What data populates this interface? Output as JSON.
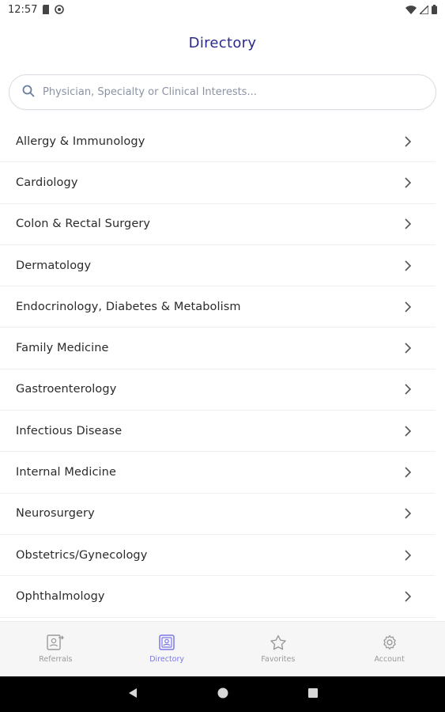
{
  "status_bar": {
    "time": "12:57"
  },
  "header": {
    "title": "Directory"
  },
  "search": {
    "placeholder": "Physician, Specialty or Clinical Interests..."
  },
  "specialties": [
    {
      "label": "Allergy & Immunology"
    },
    {
      "label": "Cardiology"
    },
    {
      "label": "Colon & Rectal Surgery"
    },
    {
      "label": "Dermatology"
    },
    {
      "label": "Endocrinology, Diabetes & Metabolism"
    },
    {
      "label": "Family Medicine"
    },
    {
      "label": "Gastroenterology"
    },
    {
      "label": "Infectious Disease"
    },
    {
      "label": "Internal Medicine"
    },
    {
      "label": "Neurosurgery"
    },
    {
      "label": "Obstetrics/Gynecology"
    },
    {
      "label": "Ophthalmology"
    }
  ],
  "bottom_nav": [
    {
      "label": "Referrals",
      "icon": "referrals-icon",
      "active": false
    },
    {
      "label": "Directory",
      "icon": "directory-icon",
      "active": true
    },
    {
      "label": "Favorites",
      "icon": "star-icon",
      "active": false
    },
    {
      "label": "Account",
      "icon": "gear-icon",
      "active": false
    }
  ],
  "colors": {
    "title": "#2a2a8a",
    "active_tab": "#7a78e8",
    "inactive_tab": "#9a9a9a"
  }
}
